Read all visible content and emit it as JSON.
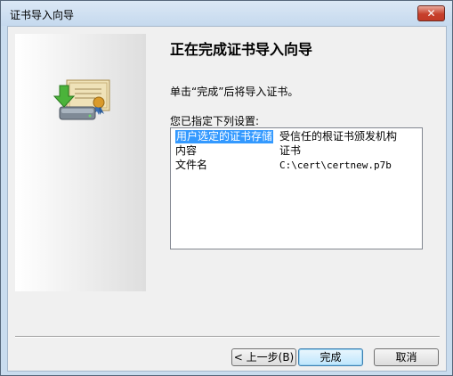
{
  "window": {
    "title": "证书导入向导",
    "close_label": "✕"
  },
  "wizard": {
    "heading": "正在完成证书导入向导",
    "description": "单击“完成”后将导入证书。",
    "settings_label": "您已指定下列设置:",
    "settings": [
      {
        "name": "用户选定的证书存储",
        "value": "受信任的根证书颁发机构"
      },
      {
        "name": "内容",
        "value": "证书"
      },
      {
        "name": "文件名",
        "value": "C:\\cert\\certnew.p7b"
      }
    ]
  },
  "buttons": {
    "back": "< 上一步(B)",
    "finish": "完成",
    "cancel": "取消"
  },
  "icons": {
    "side": "certificate-import-icon"
  },
  "colors": {
    "selection": "#3399ff",
    "close_button": "#c7402c"
  }
}
